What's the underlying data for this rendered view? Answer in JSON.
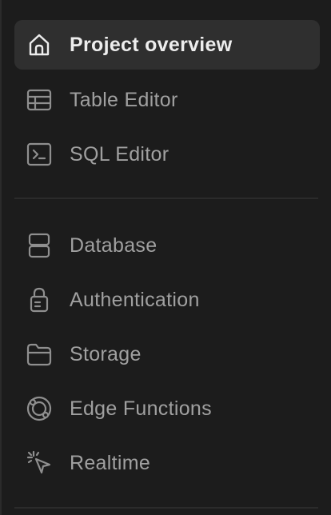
{
  "sidebar": {
    "top_items": [
      {
        "label": "Project overview",
        "icon": "home-icon",
        "active": true
      },
      {
        "label": "Table Editor",
        "icon": "table-icon",
        "active": false
      },
      {
        "label": "SQL Editor",
        "icon": "terminal-icon",
        "active": false
      }
    ],
    "bottom_items": [
      {
        "label": "Database",
        "icon": "database-icon",
        "active": false
      },
      {
        "label": "Authentication",
        "icon": "lock-icon",
        "active": false
      },
      {
        "label": "Storage",
        "icon": "folder-icon",
        "active": false
      },
      {
        "label": "Edge Functions",
        "icon": "edge-functions-icon",
        "active": false
      },
      {
        "label": "Realtime",
        "icon": "cursor-click-icon",
        "active": false
      }
    ]
  },
  "colors": {
    "background": "#1c1c1c",
    "active_background": "#2f2f2f",
    "active_text": "#ededed",
    "inactive_text": "#a0a0a0",
    "divider": "#2b2b2b"
  }
}
